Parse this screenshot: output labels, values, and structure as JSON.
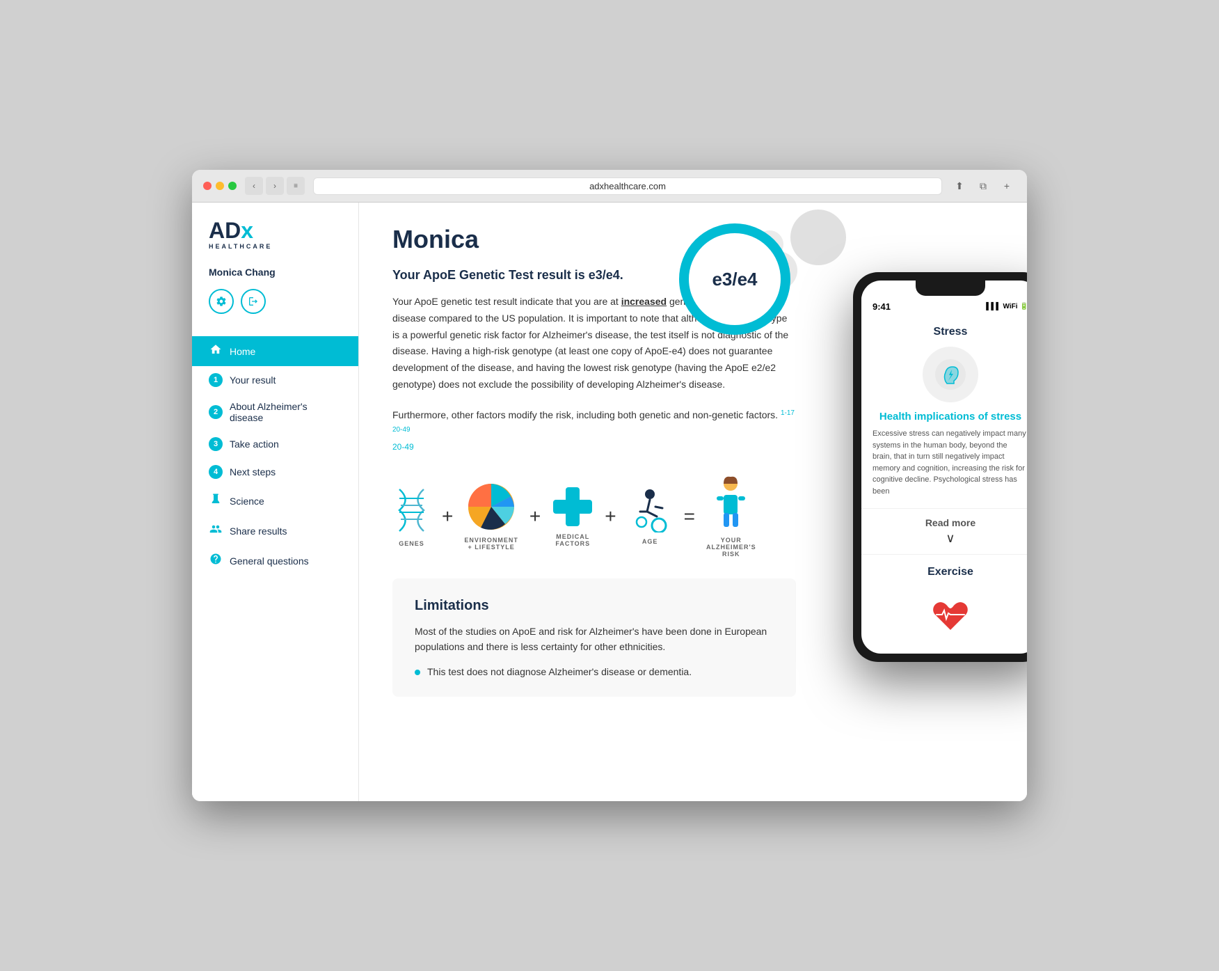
{
  "browser": {
    "url": "adxhealthcare.com",
    "dots": [
      "red",
      "yellow",
      "green"
    ]
  },
  "logo": {
    "ad": "AD",
    "x": "x",
    "subtitle": "HEALTHCARE"
  },
  "sidebar": {
    "user_name": "Monica Chang",
    "nav_items": [
      {
        "id": "home",
        "type": "icon",
        "icon": "🏠",
        "label": "Home",
        "active": true
      },
      {
        "id": "your-result",
        "type": "number",
        "number": "1",
        "label": "Your result",
        "active": false
      },
      {
        "id": "about-alzheimers",
        "type": "number",
        "number": "2",
        "label": "About Alzheimer's disease",
        "active": false
      },
      {
        "id": "take-action",
        "type": "number",
        "number": "3",
        "label": "Take action",
        "active": false
      },
      {
        "id": "next-steps",
        "type": "number",
        "number": "4",
        "label": "Next steps",
        "active": false
      },
      {
        "id": "science",
        "type": "icon",
        "icon": "🧬",
        "label": "Science",
        "active": false
      },
      {
        "id": "share-results",
        "type": "icon",
        "icon": "👥",
        "label": "Share results",
        "active": false
      },
      {
        "id": "general-questions",
        "type": "icon",
        "icon": "❓",
        "label": "General questions",
        "active": false
      }
    ]
  },
  "main": {
    "page_title": "Monica",
    "result_heading": "Your ApoE Genetic Test result is e3/e4.",
    "result_badge": "e3/e4",
    "description_1": "Your ApoE genetic test result indicate that you are at ",
    "description_bold": "increased",
    "description_2": " genetic risk for Alzheimer's disease compared to the US population. It is important to note that although ApoE genotype is a powerful genetic risk factor for Alzheimer's disease, the test itself is not diagnostic of the disease. Having a high-risk genotype (at least one copy of ApoE-e4) does not guarantee development of the disease, and having the lowest risk genotype (having the ApoE e2/e2 genotype) does not exclude the possibility of developing Alzheimer's disease.",
    "description_3": "Furthermore, other factors modify the risk, including both genetic and non-genetic factors.",
    "references": "1-17 20-49",
    "equation": {
      "items": [
        {
          "label": "GENES",
          "type": "dna"
        },
        {
          "label": "ENVIRONMENT\n+ LIFESTYLE",
          "type": "pie"
        },
        {
          "label": "MEDICAL\nFACTORS",
          "type": "cross"
        },
        {
          "label": "AGE",
          "type": "wheelchair"
        },
        {
          "label": "YOUR\nALZHEIMER'S\nRISK",
          "type": "person"
        }
      ]
    },
    "limitations": {
      "title": "Limitations",
      "description": "Most of the studies on ApoE and risk for Alzheimer's have been done in European populations and there is less certainty for other ethnicities.",
      "bullets": [
        "This test does not diagnose Alzheimer's disease or dementia."
      ]
    }
  },
  "phone": {
    "time": "9:41",
    "sections": [
      {
        "title": "Stress",
        "link_title": "Health implications of stress",
        "body": "Excessive stress can negatively impact many systems in the human body, beyond the brain, that in turn still negatively impact memory and cognition, increasing the risk for cognitive decline. Psychological stress has been"
      }
    ],
    "read_more_label": "Read more",
    "exercise_title": "Exercise"
  }
}
